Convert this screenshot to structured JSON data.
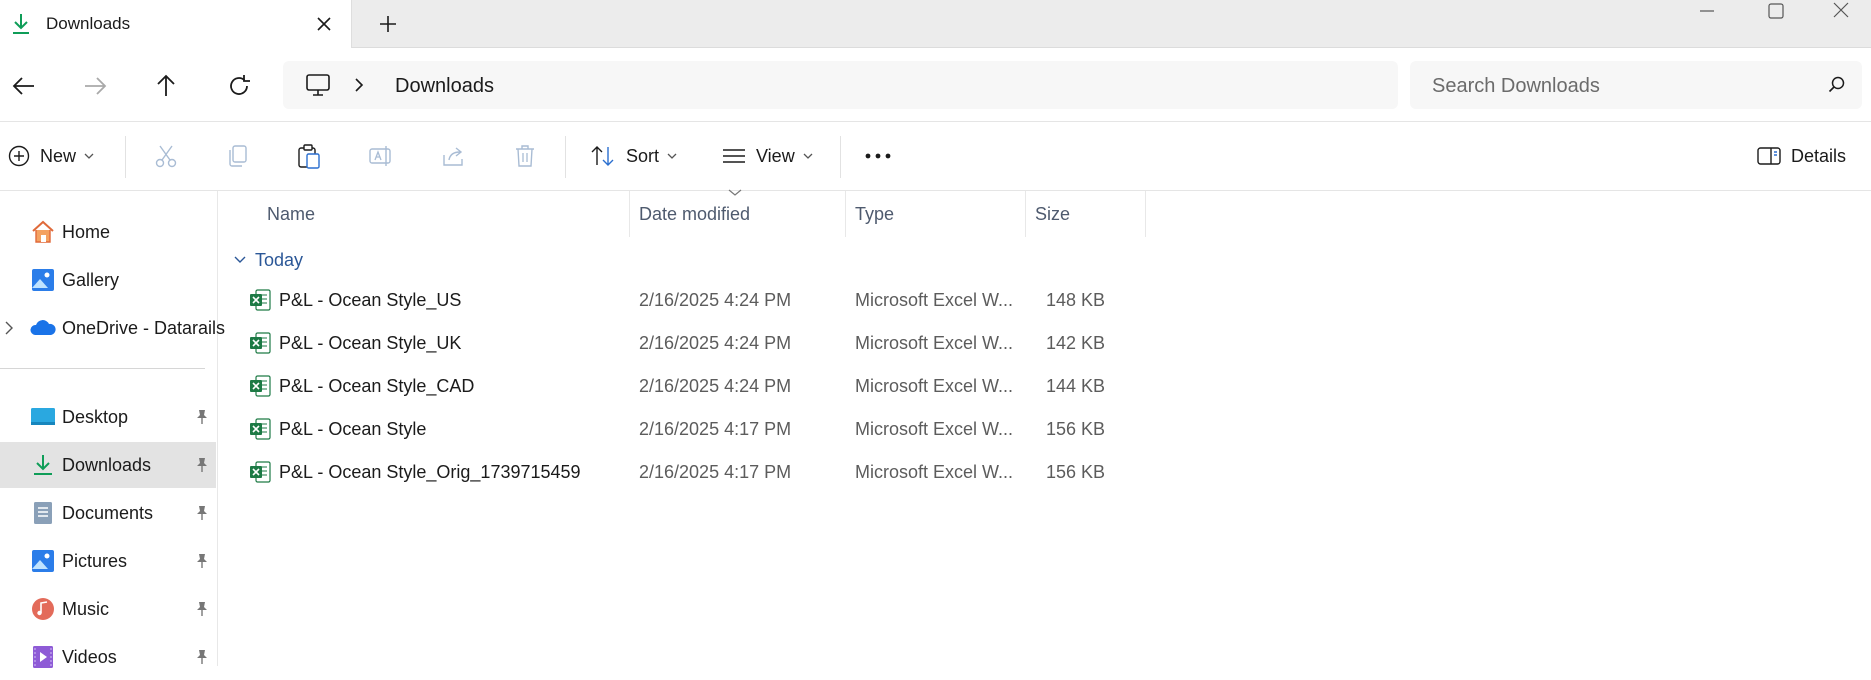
{
  "window": {
    "tab_title": "Downloads",
    "colors": {
      "accent": "#0f9d58",
      "selected_bg": "#e3e3e3",
      "header_text": "#4e5a6e",
      "group_text": "#2b5797"
    }
  },
  "address": {
    "location_icon": "this-pc-icon",
    "crumb": "Downloads",
    "search_placeholder": "Search Downloads"
  },
  "commands": {
    "new_label": "New",
    "sort_label": "Sort",
    "view_label": "View",
    "details_label": "Details",
    "icons": [
      "cut-icon",
      "copy-icon",
      "paste-icon",
      "rename-icon",
      "share-icon",
      "delete-icon",
      "more-icon"
    ]
  },
  "sidebar": {
    "top_items": [
      {
        "label": "Home",
        "icon": "home-icon"
      },
      {
        "label": "Gallery",
        "icon": "gallery-icon"
      },
      {
        "label": "OneDrive - Datarails",
        "icon": "onedrive-icon"
      }
    ],
    "pinned_items": [
      {
        "label": "Desktop",
        "icon": "desktop-icon"
      },
      {
        "label": "Downloads",
        "icon": "downloads-icon",
        "selected": true
      },
      {
        "label": "Documents",
        "icon": "documents-icon"
      },
      {
        "label": "Pictures",
        "icon": "pictures-icon"
      },
      {
        "label": "Music",
        "icon": "music-icon"
      },
      {
        "label": "Videos",
        "icon": "videos-icon"
      }
    ]
  },
  "columns": {
    "name": "Name",
    "date": "Date modified",
    "type": "Type",
    "size": "Size"
  },
  "group_label": "Today",
  "files": [
    {
      "name": "P&L - Ocean Style_US",
      "date": "2/16/2025 4:24 PM",
      "type": "Microsoft Excel W...",
      "size": "148 KB"
    },
    {
      "name": "P&L - Ocean Style_UK",
      "date": "2/16/2025 4:24 PM",
      "type": "Microsoft Excel W...",
      "size": "142 KB"
    },
    {
      "name": "P&L - Ocean Style_CAD",
      "date": "2/16/2025 4:24 PM",
      "type": "Microsoft Excel W...",
      "size": "144 KB"
    },
    {
      "name": "P&L - Ocean Style",
      "date": "2/16/2025 4:17 PM",
      "type": "Microsoft Excel W...",
      "size": "156 KB"
    },
    {
      "name": "P&L - Ocean Style_Orig_1739715459",
      "date": "2/16/2025 4:17 PM",
      "type": "Microsoft Excel W...",
      "size": "156 KB"
    }
  ]
}
